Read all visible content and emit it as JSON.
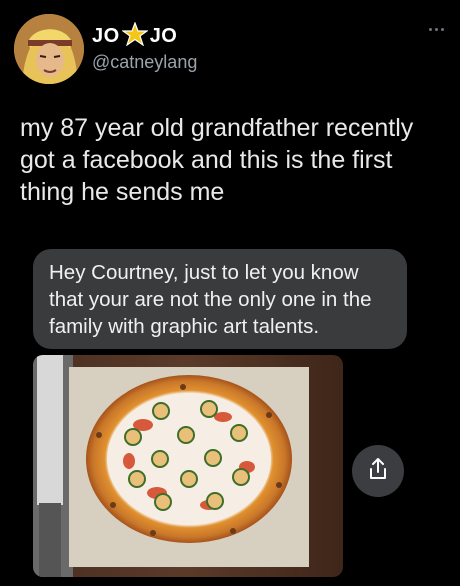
{
  "tweet": {
    "display_name_left": "JO",
    "display_name_right": "JO",
    "handle": "@catneylang",
    "text": "my 87 year old grandfather recently got a facebook and this is the first thing he sends me"
  },
  "message": {
    "text": "Hey Courtney, just to let you know that your are not the only one in the family with graphic art talents."
  },
  "icons": {
    "more": "more-options-icon",
    "share": "share-icon",
    "name_badge": "star-icon"
  },
  "colors": {
    "background": "#000000",
    "bubble": "#3a3b3d",
    "handle": "#9aa3ab",
    "star": "#f5c518"
  }
}
